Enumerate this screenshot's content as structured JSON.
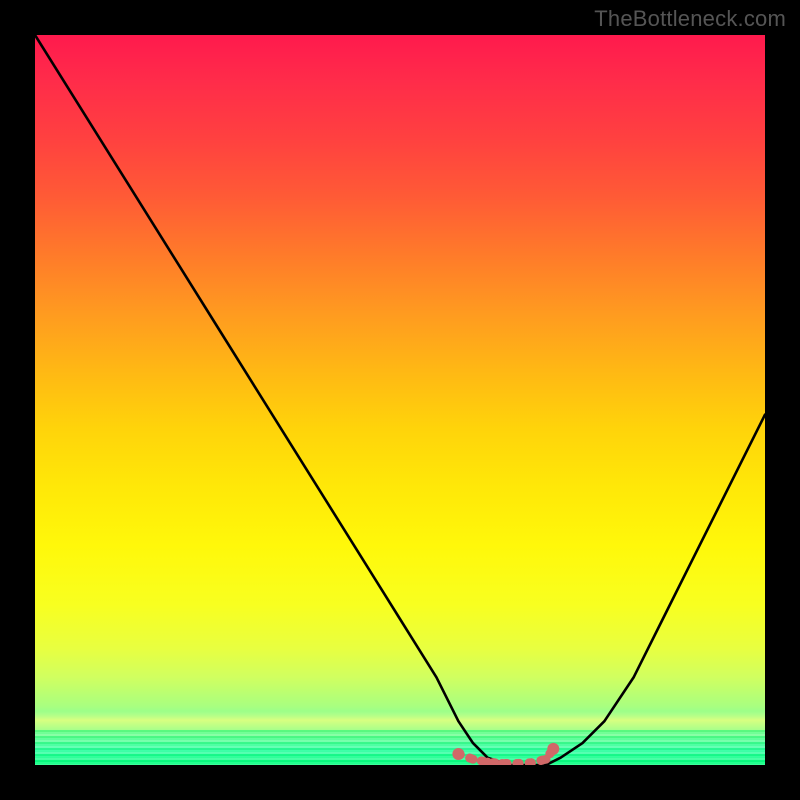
{
  "watermark": "TheBottleneck.com",
  "chart_data": {
    "type": "line",
    "title": "",
    "xlabel": "",
    "ylabel": "",
    "xlim": [
      0,
      100
    ],
    "ylim": [
      0,
      100
    ],
    "series": [
      {
        "name": "bottleneck-curve",
        "x": [
          0,
          5,
          10,
          15,
          20,
          25,
          30,
          35,
          40,
          45,
          50,
          55,
          58,
          60,
          62,
          65,
          68,
          70,
          72,
          75,
          78,
          82,
          86,
          90,
          94,
          98,
          100
        ],
        "values": [
          100,
          92,
          84,
          76,
          68,
          60,
          52,
          44,
          36,
          28,
          20,
          12,
          6,
          3,
          1,
          0,
          0,
          0,
          1,
          3,
          6,
          12,
          20,
          28,
          36,
          44,
          48
        ]
      }
    ],
    "markers": {
      "color": "#d16868",
      "points_x": [
        58,
        60,
        62,
        64,
        66,
        68,
        70,
        71
      ],
      "points_y": [
        1.5,
        0.8,
        0.4,
        0.2,
        0.2,
        0.3,
        0.8,
        2.2
      ]
    },
    "background_gradient": {
      "top": "#ff1a4d",
      "middle": "#ffe808",
      "bottom": "#00ff70"
    }
  }
}
